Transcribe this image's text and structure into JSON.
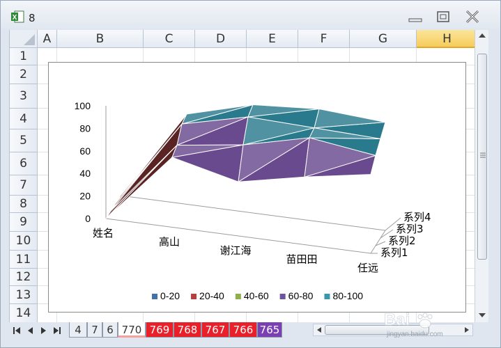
{
  "window": {
    "title": "8",
    "minimize_icon": "minimize-icon",
    "maximize_icon": "maximize-icon",
    "close_icon": "close-icon"
  },
  "sheet": {
    "columns": [
      "A",
      "B",
      "C",
      "D",
      "E",
      "F",
      "G",
      "H"
    ],
    "selected_column": "H",
    "rows": [
      "1",
      "2",
      "3",
      "4",
      "5",
      "6",
      "7",
      "8",
      "9",
      "10",
      "11",
      "12",
      "13",
      "14"
    ]
  },
  "tabs": {
    "nav_icons": [
      "first-sheet-icon",
      "prev-sheet-icon",
      "next-sheet-icon",
      "last-sheet-icon"
    ],
    "sheets": [
      {
        "label": "4",
        "color": "#e9eef4"
      },
      {
        "label": "7",
        "color": "#e9eef4"
      },
      {
        "label": "6",
        "color": "#e9eef4"
      },
      {
        "label": "770",
        "color": "#ffffff"
      },
      {
        "label": "769",
        "color": "#e8202a"
      },
      {
        "label": "768",
        "color": "#e8202a"
      },
      {
        "label": "767",
        "color": "#e8202a"
      },
      {
        "label": "766",
        "color": "#e8202a"
      },
      {
        "label": "765",
        "color": "#7b3fb4"
      }
    ]
  },
  "watermark": {
    "text": "Baidu经验",
    "subtext": "jingyan.baidu.com"
  },
  "chart_data": {
    "type": "surface",
    "categories": [
      "姓名",
      "高山",
      "谢江海",
      "苗田田",
      "任远"
    ],
    "series": [
      {
        "name": "系列1"
      },
      {
        "name": "系列2"
      },
      {
        "name": "系列3"
      },
      {
        "name": "系列4"
      }
    ],
    "z_ticks": [
      "0",
      "20",
      "40",
      "60",
      "80",
      "100"
    ],
    "zlim": [
      0,
      100
    ],
    "legend": [
      {
        "label": "0-20",
        "color": "#4472a8"
      },
      {
        "label": "20-40",
        "color": "#b0413e"
      },
      {
        "label": "40-60",
        "color": "#8fae4f"
      },
      {
        "label": "60-80",
        "color": "#6e549c"
      },
      {
        "label": "80-100",
        "color": "#3c96ad"
      }
    ],
    "legend_position": "bottom"
  }
}
